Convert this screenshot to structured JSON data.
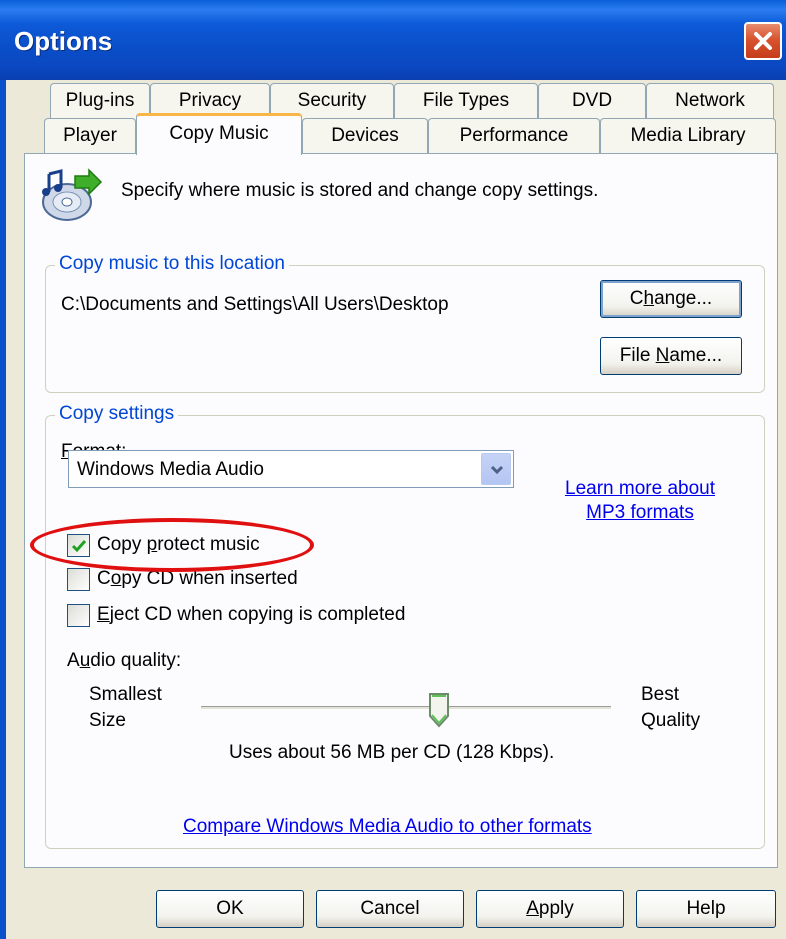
{
  "window": {
    "title": "Options"
  },
  "tabs_row1": [
    "Plug-ins",
    "Privacy",
    "Security",
    "File Types",
    "DVD",
    "Network"
  ],
  "tabs_row2": [
    "Player",
    "Copy Music",
    "Devices",
    "Performance",
    "Media Library"
  ],
  "active_tab": "Copy Music",
  "header": {
    "description": "Specify where music is stored and change copy settings."
  },
  "location": {
    "group_label": "Copy music to this location",
    "path": "C:\\Documents and Settings\\All Users\\Desktop",
    "change_button_label_pre": "C",
    "change_button_label_u": "h",
    "change_button_label_post": "ange...",
    "filename_button_label_pre": "File ",
    "filename_button_label_u": "N",
    "filename_button_label_post": "ame..."
  },
  "copy_settings": {
    "group_label": "Copy settings",
    "format_label_u": "F",
    "format_label_post": "ormat:",
    "format_value": "Windows Media Audio",
    "learn_more_line1": "Learn more about",
    "learn_more_line2": "MP3 formats",
    "checkboxes": [
      {
        "pre": "Copy ",
        "u": "p",
        "post": "rotect music",
        "checked": true
      },
      {
        "pre": "C",
        "u": "o",
        "post": "py CD when inserted",
        "checked": false
      },
      {
        "pre": "",
        "u": "E",
        "post": "ject CD when copying is completed",
        "checked": false
      }
    ],
    "audio_quality_label_pre": "A",
    "audio_quality_label_u": "u",
    "audio_quality_label_post": "dio quality:",
    "slider_min_line1": "Smallest",
    "slider_min_line2": "Size",
    "slider_max_line1": "Best",
    "slider_max_line2": "Quality",
    "quality_level": 0.58,
    "usage_text": "Uses about 56 MB per CD (128 Kbps).",
    "compare_link": "Compare Windows Media Audio to other formats"
  },
  "buttons": {
    "ok": "OK",
    "cancel": "Cancel",
    "apply_u": "A",
    "apply_post": "pply",
    "help": "Help"
  },
  "colors": {
    "title_bar": "#0a4ec8",
    "group_label": "#0046d5",
    "highlight": "#e01010",
    "link": "#0000ee"
  },
  "icons": [
    "cd-music-icon",
    "close-icon",
    "chevron-down-icon",
    "checkmark-icon",
    "slider-thumb-icon"
  ]
}
